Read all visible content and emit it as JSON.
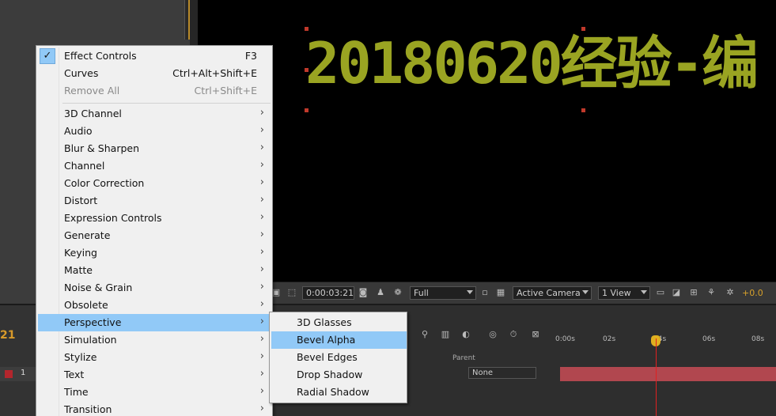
{
  "composition": {
    "title_text": "20180620经验-编",
    "timecode_left": "21"
  },
  "viewer_toolbar": {
    "timecode": "0:00:03:21",
    "resolution": "Full",
    "camera": "Active Camera",
    "views": "1 View",
    "exposure": "+0.0"
  },
  "timeline": {
    "parent_header": "Parent",
    "parent_value": "None",
    "layer_number": "1",
    "ruler_ticks": [
      "0:00s",
      "02s",
      "04s",
      "06s",
      "08s"
    ],
    "layer_color": "#b3262d"
  },
  "menu": {
    "top_items": [
      {
        "label": "Effect Controls",
        "shortcut": "F3",
        "checked": true,
        "disabled": false
      },
      {
        "label": "Curves",
        "shortcut": "Ctrl+Alt+Shift+E",
        "checked": false,
        "disabled": false
      },
      {
        "label": "Remove All",
        "shortcut": "Ctrl+Shift+E",
        "checked": false,
        "disabled": true
      }
    ],
    "categories": [
      {
        "label": "3D Channel"
      },
      {
        "label": "Audio"
      },
      {
        "label": "Blur & Sharpen"
      },
      {
        "label": "Channel"
      },
      {
        "label": "Color Correction"
      },
      {
        "label": "Distort"
      },
      {
        "label": "Expression Controls"
      },
      {
        "label": "Generate"
      },
      {
        "label": "Keying"
      },
      {
        "label": "Matte"
      },
      {
        "label": "Noise & Grain"
      },
      {
        "label": "Obsolete"
      },
      {
        "label": "Perspective",
        "highlighted": true
      },
      {
        "label": "Simulation"
      },
      {
        "label": "Stylize"
      },
      {
        "label": "Text"
      },
      {
        "label": "Time"
      },
      {
        "label": "Transition"
      }
    ],
    "submenu": [
      {
        "label": "3D Glasses"
      },
      {
        "label": "Bevel Alpha",
        "highlighted": true
      },
      {
        "label": "Bevel Edges"
      },
      {
        "label": "Drop Shadow"
      },
      {
        "label": "Radial Shadow"
      }
    ],
    "highlight_color": "#91c9f7"
  }
}
